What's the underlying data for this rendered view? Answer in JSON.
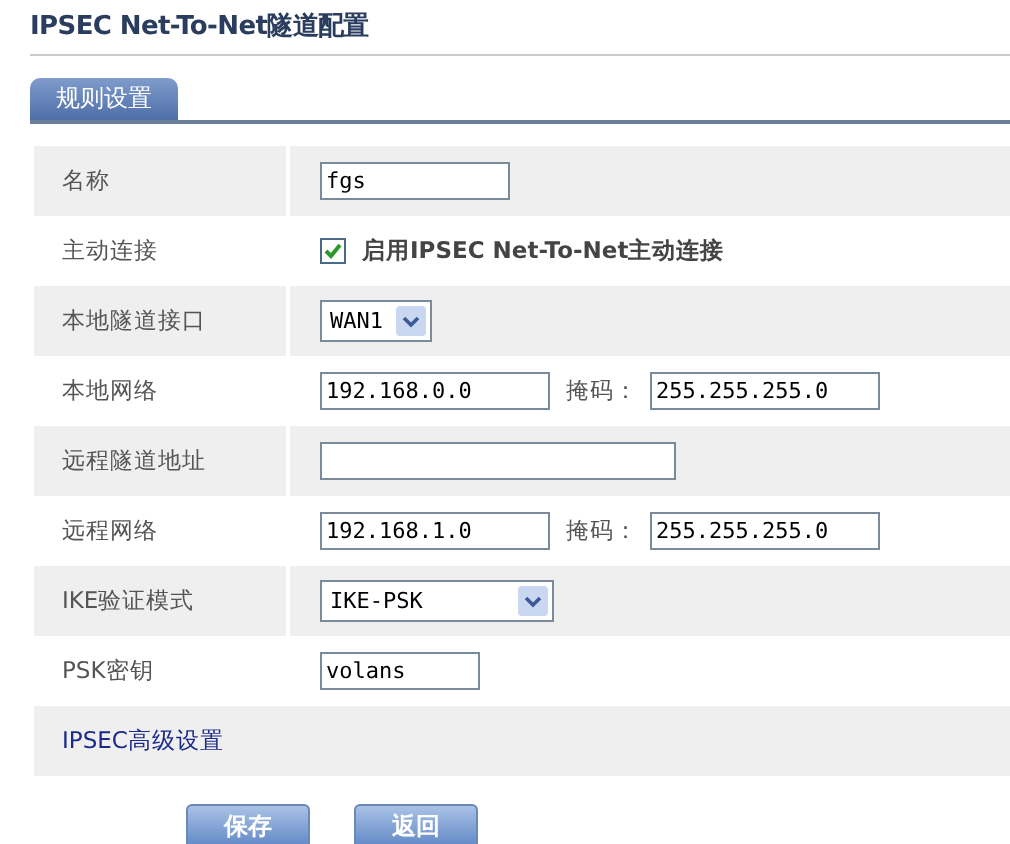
{
  "title": "IPSEC Net-To-Net隧道配置",
  "tabs": [
    {
      "label": "规则设置",
      "selected": true
    }
  ],
  "rows": [
    {
      "kind": "text",
      "label": "名称",
      "value": "fgs"
    },
    {
      "kind": "checkbox",
      "label": "主动连接",
      "checked": true,
      "text": "启用IPSEC Net-To-Net主动连接"
    },
    {
      "kind": "select",
      "label": "本地隧道接口",
      "value": "WAN1"
    },
    {
      "kind": "network",
      "label": "本地网络",
      "value": "192.168.0.0",
      "mask_label": "掩码：",
      "mask_value": "255.255.255.0"
    },
    {
      "kind": "text",
      "label": "远程隧道地址"
    },
    {
      "kind": "network",
      "label": "远程网络",
      "value": "192.168.1.0",
      "mask_label": "掩码：",
      "mask_value": "255.255.255.0"
    },
    {
      "kind": "select",
      "label": "IKE验证模式",
      "value": "IKE-PSK"
    },
    {
      "kind": "text",
      "label": "PSK密钥",
      "value": "volans"
    },
    {
      "kind": "link",
      "label": "IPSEC高级设置"
    }
  ],
  "buttons": [
    "保存",
    "返回"
  ]
}
